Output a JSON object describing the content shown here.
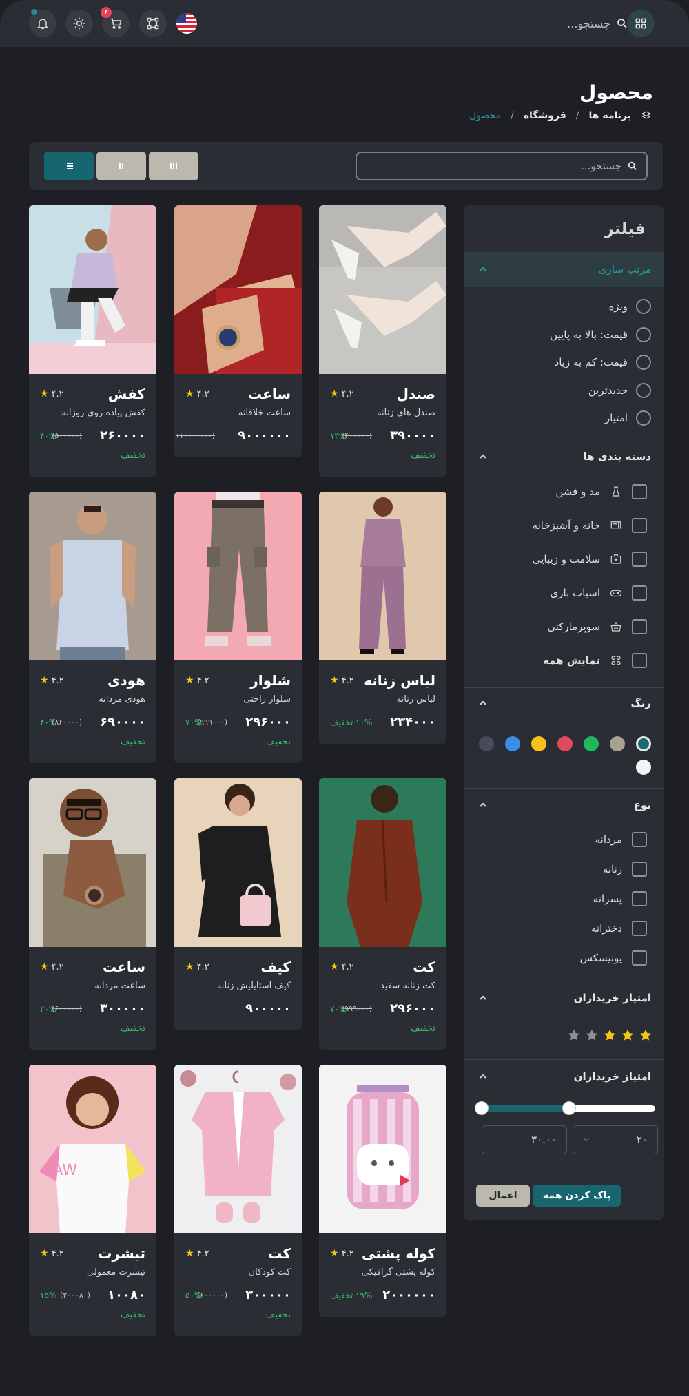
{
  "topbar": {
    "search_placeholder": "جستجو...",
    "cart_badge": "۴"
  },
  "header": {
    "title": "محصول",
    "breadcrumb": [
      "برنامه ها",
      "فروشگاه",
      "محصول"
    ]
  },
  "toolbar": {
    "search_placeholder": "جستجو..."
  },
  "filter": {
    "title": "فیلتر",
    "sort": {
      "label": "مرتب سازی",
      "options": [
        "ویژه",
        "قیمت: بالا به پایین",
        "قیمت: کم به زیاد",
        "جدیدترین",
        "امتیاز"
      ]
    },
    "categories": {
      "label": "دسته بندی ها",
      "items": [
        "مد و فشن",
        "خانه و آشپزخانه",
        "سلامت و زیبایی",
        "اسباب بازی",
        "سوپرمارکتی",
        "نمایش همه"
      ]
    },
    "color": {
      "label": "رنگ",
      "swatches": [
        "#1a6a73",
        "#a99f92",
        "#1fb85a",
        "#e04a5c",
        "#f7c21b",
        "#3b8de7",
        "#494a5c",
        "#f4f4f4"
      ]
    },
    "type": {
      "label": "نوع",
      "items": [
        "مردانه",
        "زنانه",
        "پسرانه",
        "دخترانه",
        "یونیسکس"
      ]
    },
    "rating": {
      "label": "امتیاز خریداران",
      "value": 3,
      "max": 5
    },
    "price": {
      "label": "امتیاز خریداران",
      "min_value": "۲۰",
      "max_value": "۳۰.۰۰",
      "range_low": 0,
      "range_high": 0.52
    },
    "clear_label": "پاک کردن همه",
    "apply_label": "اعمال"
  },
  "products": [
    {
      "name": "صندل",
      "sub": "صندل های زنانه",
      "rating": "۴.۲",
      "price": "۳۹۰۰۰۰",
      "old": "(۴۰۰۰۰۰)",
      "pct": "۱۳%",
      "disc": "تخفیف"
    },
    {
      "name": "ساعت",
      "sub": "ساعت خلاقانه",
      "rating": "۴.۲",
      "price": "۹۰۰۰۰۰۰",
      "old": "(۱۰۰۰۰۰۰۰)",
      "pct": "",
      "disc": ""
    },
    {
      "name": "کفش",
      "sub": "کفش پیاده روی روزانه",
      "rating": "۴.۲",
      "price": "۲۶۰۰۰۰",
      "old": "(۵۰۰۰۰۰)",
      "pct": "۴۰%",
      "disc": "تخفیف"
    },
    {
      "name": "لباس زنانه",
      "sub": "لباس زنانه",
      "rating": "۴.۲",
      "price": "۲۳۴۰۰۰",
      "old": "",
      "pct": "۱۰% تخفیف",
      "disc": ""
    },
    {
      "name": "شلوار",
      "sub": "شلوار راحتی",
      "rating": "۴.۲",
      "price": "۲۹۶۰۰۰",
      "old": "(۹۹۹۰۰۰)",
      "pct": "۷۰%",
      "disc": "تخفیف"
    },
    {
      "name": "هودی",
      "sub": "هودی مردانه",
      "rating": "۴.۲",
      "price": "۶۹۰۰۰۰",
      "old": "(۸۶۰۰۰۰)",
      "pct": "۴۰%",
      "disc": "تخفیف"
    },
    {
      "name": "کت",
      "sub": "کت زنانه سفید",
      "rating": "۴.۲",
      "price": "۲۹۶۰۰۰",
      "old": "(۹۹۹۰۰۰)",
      "pct": "۷۰%",
      "disc": "تخفیف"
    },
    {
      "name": "کیف",
      "sub": "کیف استایلیش زنانه",
      "rating": "۴.۲",
      "price": "۹۰۰۰۰۰",
      "old": "",
      "pct": "",
      "disc": ""
    },
    {
      "name": "ساعت",
      "sub": "ساعت مردانه",
      "rating": "۴.۲",
      "price": "۳۰۰۰۰۰",
      "old": "(۶۰۰۰۰۰)",
      "pct": "۲۰%",
      "disc": "تخفیف"
    },
    {
      "name": "کوله پشتی",
      "sub": "کوله پشتی گرافیکی",
      "rating": "۴.۲",
      "price": "۲۰۰۰۰۰۰",
      "old": "",
      "pct": "۱۹% تخفیف",
      "disc": ""
    },
    {
      "name": "کت",
      "sub": "کت کودکان",
      "rating": "۴.۲",
      "price": "۳۰۰۰۰۰",
      "old": "(۶۰۰۰۰۰)",
      "pct": "۵۰%",
      "disc": "تخفیف"
    },
    {
      "name": "تیشرت",
      "sub": "تیشرت معمولی",
      "rating": "۴.۲",
      "price": "۱۰۰۸۰",
      "old": "(۳۰۰۰۸۰)",
      "pct": "۱۵%",
      "disc": "تخفیف"
    }
  ]
}
